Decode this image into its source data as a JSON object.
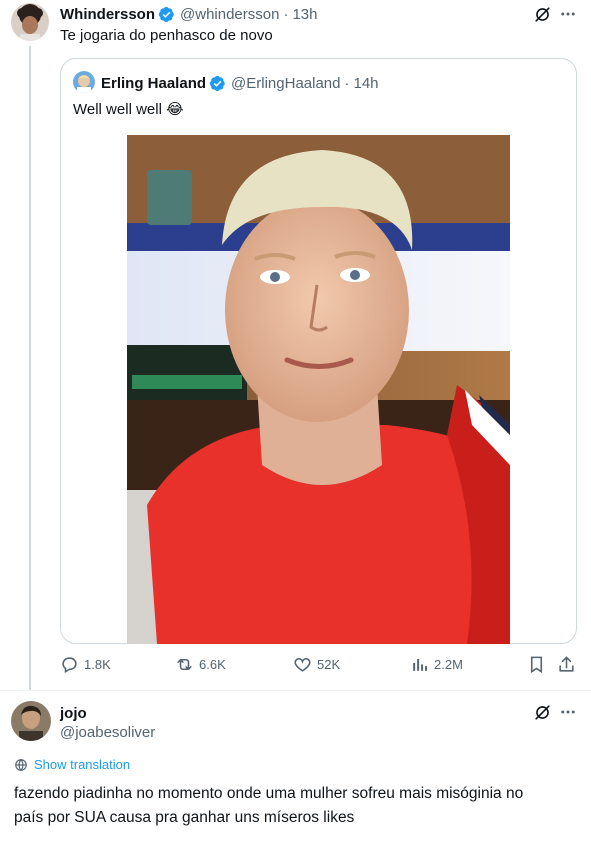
{
  "post": {
    "author_name": "Whindersson",
    "handle": "@whindersson",
    "time": "13h",
    "text": "Te jogaria do penhasco de novo",
    "stats": {
      "replies": "1.8K",
      "reposts": "6.6K",
      "likes": "52K",
      "views": "2.2M"
    }
  },
  "quoted": {
    "author_name": "Erling Haaland",
    "handle": "@ErlingHaaland",
    "time": "14h",
    "text": "Well well well",
    "emoji": "😂"
  },
  "reply": {
    "author_name": "jojo",
    "handle": "@joabesoliver",
    "translate_label": "Show translation",
    "text_line1": "fazendo piadinha no momento onde uma mulher sofreu mais misóginia no",
    "text_line2": "país por SUA causa pra ganhar uns míseros likes"
  },
  "colors": {
    "verified": "#1d9bf0",
    "muted": "#536471",
    "link": "#1d9bf0",
    "jersey": "#e8312a"
  }
}
